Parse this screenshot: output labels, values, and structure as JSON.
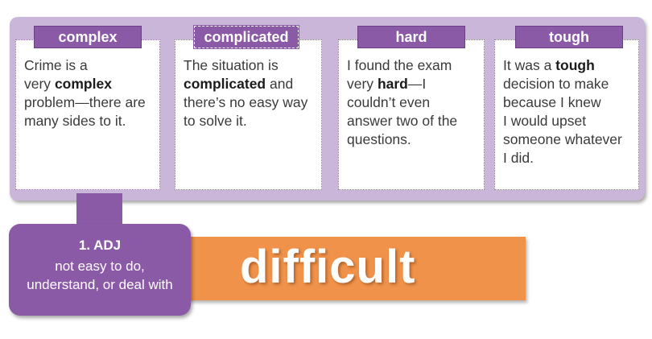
{
  "synonyms": [
    {
      "word": "complex",
      "example": [
        {
          "t": "Crime is a"
        },
        {
          "br": true
        },
        {
          "t": "very "
        },
        {
          "t": "complex",
          "b": true
        },
        {
          "br": true
        },
        {
          "t": "problem—there are"
        },
        {
          "br": true
        },
        {
          "t": "many sides to it."
        }
      ]
    },
    {
      "word": "complicated",
      "example": [
        {
          "t": "The situation is"
        },
        {
          "br": true
        },
        {
          "t": "complicated",
          "b": true
        },
        {
          "t": " and"
        },
        {
          "br": true
        },
        {
          "t": "there’s no easy way"
        },
        {
          "br": true
        },
        {
          "t": "to solve it."
        }
      ]
    },
    {
      "word": "hard",
      "example": [
        {
          "t": "I found the exam"
        },
        {
          "br": true
        },
        {
          "t": "very "
        },
        {
          "t": "hard",
          "b": true
        },
        {
          "t": "—I"
        },
        {
          "br": true
        },
        {
          "t": "couldn’t even"
        },
        {
          "br": true
        },
        {
          "t": "answer two of the"
        },
        {
          "br": true
        },
        {
          "t": "questions."
        }
      ]
    },
    {
      "word": "tough",
      "example": [
        {
          "t": "It was a "
        },
        {
          "t": "tough",
          "b": true
        },
        {
          "br": true
        },
        {
          "t": "decision to make"
        },
        {
          "br": true
        },
        {
          "t": "because I knew"
        },
        {
          "br": true
        },
        {
          "t": "I would upset"
        },
        {
          "br": true
        },
        {
          "t": "someone whatever"
        },
        {
          "br": true
        },
        {
          "t": "I did."
        }
      ]
    }
  ],
  "sense": {
    "label": "1. ADJ",
    "definition_line1": "not easy to do,",
    "definition_line2": "understand, or deal with"
  },
  "headword": "difficult",
  "colors": {
    "purple": "#8b5aa6",
    "lavender": "#c9b6d8",
    "orange": "#f0924a"
  }
}
